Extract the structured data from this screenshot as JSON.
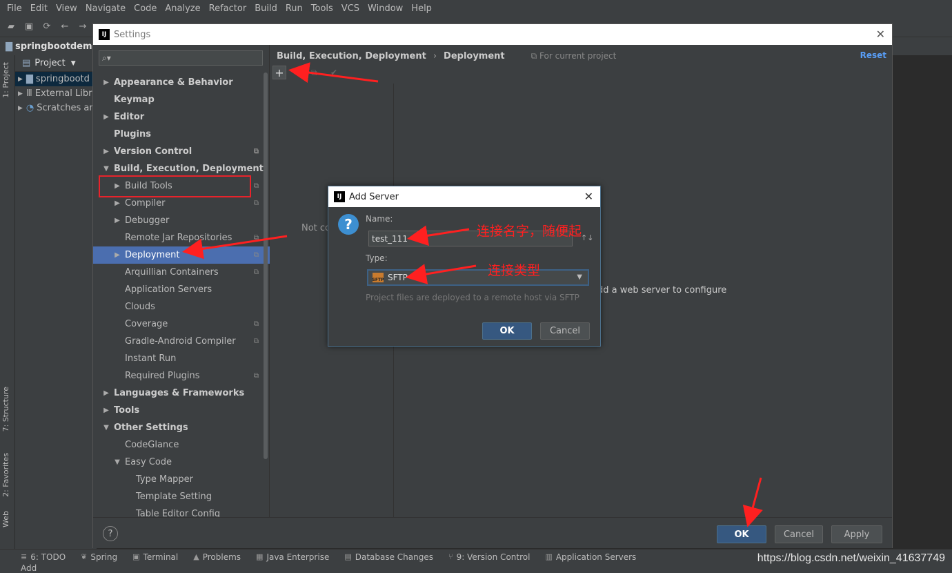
{
  "menu": [
    "File",
    "Edit",
    "View",
    "Navigate",
    "Code",
    "Analyze",
    "Refactor",
    "Build",
    "Run",
    "Tools",
    "VCS",
    "Window",
    "Help"
  ],
  "navbar": {
    "project": "springbootdemo"
  },
  "project_panel": {
    "header": "Project",
    "items": [
      "springbootd",
      "External Libr",
      "Scratches an"
    ]
  },
  "left_tabs": {
    "project": "1: Project",
    "structure": "7: Structure",
    "favorites": "2: Favorites",
    "web": "Web"
  },
  "settings": {
    "title": "Settings",
    "tree": [
      {
        "label": "Appearance & Behavior",
        "bold": true,
        "arrow": "right",
        "indent": 0
      },
      {
        "label": "Keymap",
        "bold": true,
        "arrow": "",
        "indent": 0
      },
      {
        "label": "Editor",
        "bold": true,
        "arrow": "right",
        "indent": 0
      },
      {
        "label": "Plugins",
        "bold": true,
        "arrow": "",
        "indent": 0
      },
      {
        "label": "Version Control",
        "bold": true,
        "arrow": "right",
        "indent": 0,
        "copy": true
      },
      {
        "label": "Build, Execution, Deployment",
        "bold": true,
        "arrow": "down",
        "indent": 0
      },
      {
        "label": "Build Tools",
        "bold": false,
        "arrow": "right",
        "indent": 1,
        "copy": true
      },
      {
        "label": "Compiler",
        "bold": false,
        "arrow": "right",
        "indent": 1,
        "copy": true
      },
      {
        "label": "Debugger",
        "bold": false,
        "arrow": "right",
        "indent": 1
      },
      {
        "label": "Remote Jar Repositories",
        "bold": false,
        "arrow": "",
        "indent": 1,
        "copy": true
      },
      {
        "label": "Deployment",
        "bold": false,
        "arrow": "right",
        "indent": 1,
        "copy": true,
        "selected": true
      },
      {
        "label": "Arquillian Containers",
        "bold": false,
        "arrow": "",
        "indent": 1,
        "copy": true
      },
      {
        "label": "Application Servers",
        "bold": false,
        "arrow": "",
        "indent": 1
      },
      {
        "label": "Clouds",
        "bold": false,
        "arrow": "",
        "indent": 1
      },
      {
        "label": "Coverage",
        "bold": false,
        "arrow": "",
        "indent": 1,
        "copy": true
      },
      {
        "label": "Gradle-Android Compiler",
        "bold": false,
        "arrow": "",
        "indent": 1,
        "copy": true
      },
      {
        "label": "Instant Run",
        "bold": false,
        "arrow": "",
        "indent": 1
      },
      {
        "label": "Required Plugins",
        "bold": false,
        "arrow": "",
        "indent": 1,
        "copy": true
      },
      {
        "label": "Languages & Frameworks",
        "bold": true,
        "arrow": "right",
        "indent": 0
      },
      {
        "label": "Tools",
        "bold": true,
        "arrow": "right",
        "indent": 0
      },
      {
        "label": "Other Settings",
        "bold": true,
        "arrow": "down",
        "indent": 0
      },
      {
        "label": "CodeGlance",
        "bold": false,
        "arrow": "",
        "indent": 1
      },
      {
        "label": "Easy Code",
        "bold": false,
        "arrow": "down",
        "indent": 1
      },
      {
        "label": "Type Mapper",
        "bold": false,
        "arrow": "",
        "indent": 2
      },
      {
        "label": "Template Setting",
        "bold": false,
        "arrow": "",
        "indent": 2
      },
      {
        "label": "Table Editor Config",
        "bold": false,
        "arrow": "",
        "indent": 2
      }
    ],
    "breadcrumb": {
      "parent": "Build, Execution, Deployment",
      "sep": "›",
      "current": "Deployment"
    },
    "scope": "For current project",
    "reset": "Reset",
    "not_configured": "Not co",
    "add_web_server": "dd a web server to configure",
    "buttons": {
      "ok": "OK",
      "cancel": "Cancel",
      "apply": "Apply",
      "help": "?"
    }
  },
  "add_server": {
    "title": "Add Server",
    "name_label": "Name:",
    "name_value": "test_111",
    "type_label": "Type:",
    "type_value": "SFTP",
    "hint": "Project files are deployed to a remote host via SFTP",
    "ok": "OK",
    "cancel": "Cancel"
  },
  "annotations": {
    "name_note": "连接名字，随便起",
    "type_note": "连接类型"
  },
  "bottom_tabs": [
    "6: TODO",
    "Spring",
    "Terminal",
    "Problems",
    "Java Enterprise",
    "Database Changes",
    "9: Version Control",
    "Application Servers"
  ],
  "status": "Add",
  "watermark": "https://blog.csdn.net/weixin_41637749",
  "colors": {
    "accent": "#4b6eaf",
    "primary_button": "#365880",
    "annotation": "#ff2020",
    "link": "#589df6"
  }
}
